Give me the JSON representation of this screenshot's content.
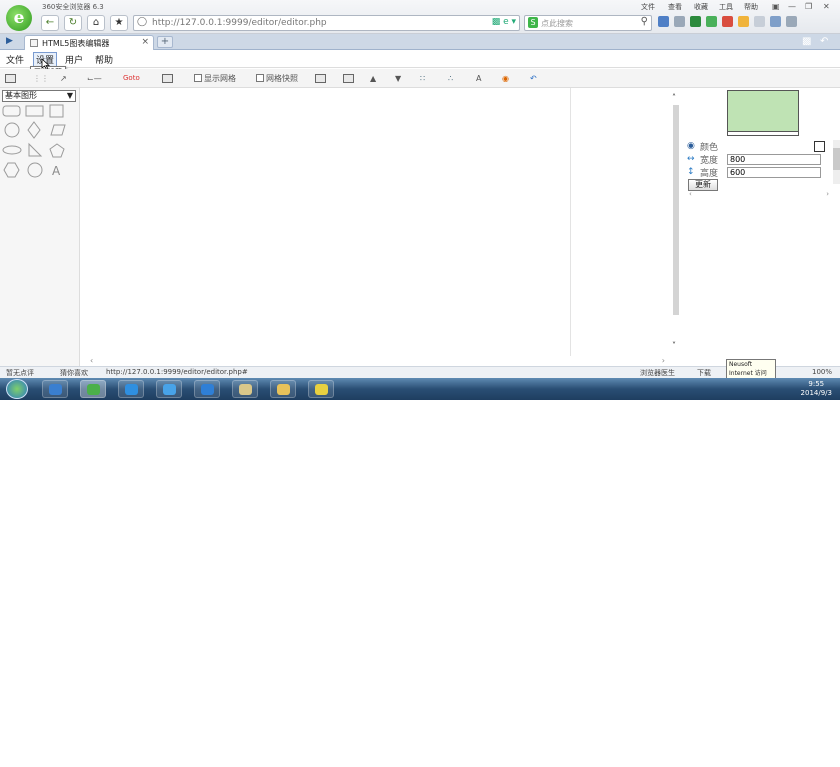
{
  "browser": {
    "title": "360安全浏览器 6.3",
    "address_url": "http://127.0.0.1:9999/editor/editor.php",
    "search_placeholder": "点此搜索",
    "top_menu": [
      "文件",
      "查看",
      "收藏",
      "工具",
      "帮助"
    ]
  },
  "tab": {
    "label": "HTML5图表编辑器"
  },
  "app_menu": {
    "items": [
      "文件",
      "设置",
      "用户",
      "帮助"
    ],
    "active_tooltip": "画布设置"
  },
  "toolbar": {
    "show_grid": "显示网格",
    "snap_grid": "网格快照",
    "goto": "Goto"
  },
  "shapes": {
    "category": "基本图形",
    "text_shape": "A"
  },
  "properties": {
    "color_label": "颜色",
    "width_label": "宽度",
    "width_value": "800",
    "height_label": "高度",
    "height_value": "600",
    "update_button": "更新",
    "preview_fill": "#bfe3b4"
  },
  "status": {
    "comment": "暂无点评",
    "guess": "猜你喜欢",
    "link_url": "http://127.0.0.1:9999/editor/editor.php#",
    "doctor": "浏览器医生",
    "download": "下载",
    "zoom": "100%"
  },
  "notification": {
    "line1": "Neusoft",
    "line2": "Internet 访问"
  },
  "taskbar": {
    "time": "9:55",
    "date": "2014/9/3"
  }
}
